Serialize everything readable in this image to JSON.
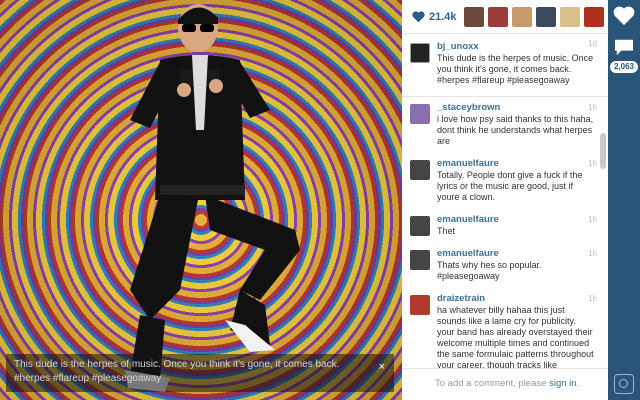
{
  "photo": {
    "caption_overlay": "This dude is the herpes of music. Once you think it's gone, it comes back. #herpes #flareup #pleasegoaway",
    "close_glyph": "×"
  },
  "likes": {
    "count": "21.4k",
    "liker_colors": [
      "#6b4a3a",
      "#9b3b3b",
      "#c79a6a",
      "#3a4a5a",
      "#d9c08a",
      "#b03020"
    ]
  },
  "caption": {
    "user": "bj_unoxx",
    "time": "1d",
    "text": "This dude is the herpes of music. Once you think it's gone, it comes back. #herpes #flareup #pleasegoaway"
  },
  "comments": [
    {
      "user": "_staceybrown",
      "time": "1h",
      "text": "i love how psy said thanks to this haha, dont think he understands what herpes are",
      "avatar_color": "#8a6fb0"
    },
    {
      "user": "emanuelfaure",
      "time": "1h",
      "text": "Totally. People dont give a fuck if the lyrics or the music are good, just if youre a clown.",
      "avatar_color": "#444444"
    },
    {
      "user": "emanuelfaure",
      "time": "1h",
      "text": "Thet",
      "avatar_color": "#444444"
    },
    {
      "user": "emanuelfaure",
      "time": "1h",
      "text": "Thats why hes so popular. #pleasegoaway",
      "avatar_color": "#444444"
    },
    {
      "user": "draizetrain",
      "time": "1h",
      "text": "ha whatever billy hahaa this just sounds like a lame cry for publicity. your band has already overstayed their welcome multiple times and continued the same formulaic patterns throughout your career. though tracks like disappearing boy is rad, i suppose others are hating",
      "avatar_color": "#b03a2e"
    }
  ],
  "add_comment": {
    "prefix": "To add a comment, please ",
    "signin": "sign in",
    "suffix": "."
  },
  "sidebar": {
    "count": "2,063"
  }
}
